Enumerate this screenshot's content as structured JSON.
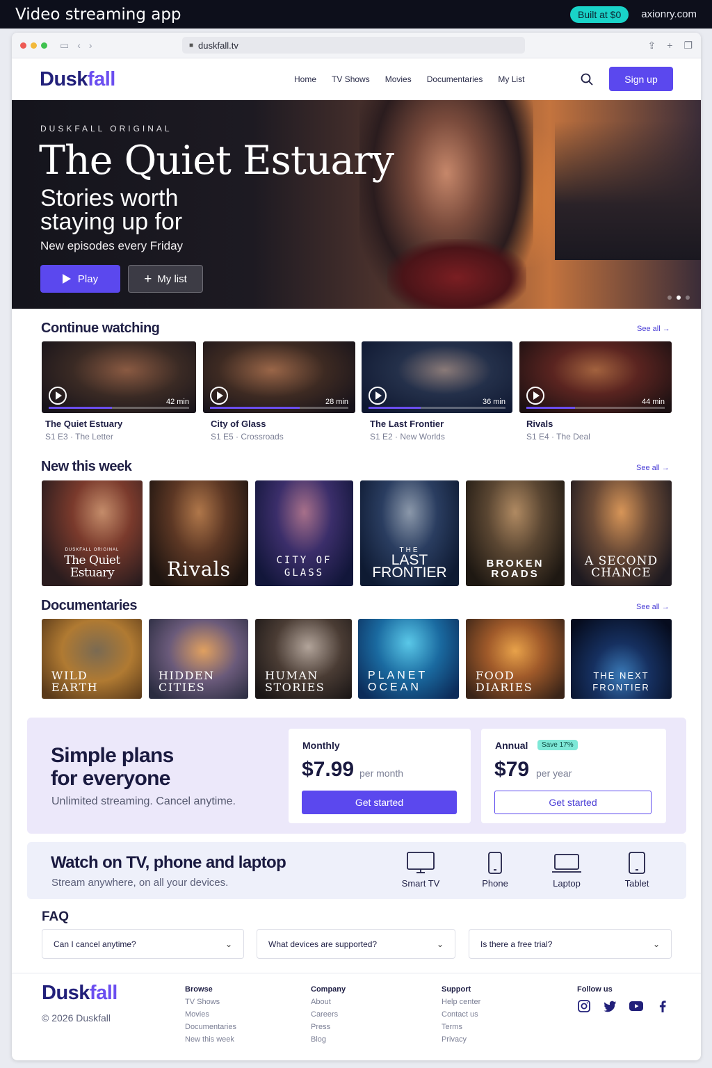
{
  "banner": {
    "title": "Video streaming app",
    "badge": "Built at $0",
    "domain": "axionry.com"
  },
  "browser": {
    "url": "duskfall.tv"
  },
  "nav": {
    "logo_a": "Dusk",
    "logo_b": "fall",
    "items": [
      "Home",
      "TV Shows",
      "Movies",
      "Documentaries",
      "My List"
    ],
    "signup": "Sign up"
  },
  "hero": {
    "eyebrow": "DUSKFALL ORIGINAL",
    "title": "The Quiet Estuary",
    "subtitle": "Stories worth staying up for",
    "desc": "New episodes every Friday",
    "play": "Play",
    "mylist": "My list",
    "slide_count": 3,
    "active_slide": 2
  },
  "continue": {
    "heading": "Continue watching",
    "see_all": "See all",
    "items": [
      {
        "title": "The Quiet Estuary",
        "sub": "S1 E3 · The Letter",
        "dur": "42 min",
        "progress": 0.45
      },
      {
        "title": "City of Glass",
        "sub": "S1 E5 · Crossroads",
        "dur": "28 min",
        "progress": 0.65
      },
      {
        "title": "The Last Frontier",
        "sub": "S1 E2 · New Worlds",
        "dur": "36 min",
        "progress": 0.38
      },
      {
        "title": "Rivals",
        "sub": "S1 E4 · The Deal",
        "dur": "44 min",
        "progress": 0.35
      }
    ]
  },
  "new": {
    "heading": "New this week",
    "see_all": "See all",
    "items": [
      {
        "title": "The Quiet Estuary",
        "eyebrow": "DUSKFALL ORIGINAL"
      },
      {
        "title": "Rivals",
        "eyebrow": ""
      },
      {
        "title": "CITY OF GLASS",
        "eyebrow": ""
      },
      {
        "title": "LAST FRONTIER",
        "eyebrow": "THE"
      },
      {
        "title": "BROKEN ROADS",
        "eyebrow": ""
      },
      {
        "title": "A SECOND CHANCE",
        "eyebrow": ""
      }
    ]
  },
  "docs": {
    "heading": "Documentaries",
    "see_all": "See all",
    "items": [
      {
        "title": "WILD EARTH"
      },
      {
        "title": "HIDDEN CITIES"
      },
      {
        "title": "HUMAN STORIES"
      },
      {
        "title": "PLANET OCEAN"
      },
      {
        "title": "FOOD DIARIES"
      },
      {
        "title": "THE NEXT FRONTIER"
      }
    ]
  },
  "plans": {
    "heading": "Simple plans for everyone",
    "sub": "Unlimited streaming. Cancel anytime.",
    "monthly": {
      "name": "Monthly",
      "price": "$7.99",
      "per": "per month",
      "cta": "Get started"
    },
    "annual": {
      "name": "Annual",
      "badge": "Save 17%",
      "price": "$79",
      "per": "per year",
      "cta": "Get started"
    }
  },
  "devices": {
    "heading": "Watch on TV, phone and laptop",
    "sub": "Stream anywhere, on all your devices.",
    "items": [
      "Smart TV",
      "Phone",
      "Laptop",
      "Tablet"
    ]
  },
  "faq": {
    "heading": "FAQ",
    "items": [
      "Can I cancel anytime?",
      "What devices are supported?",
      "Is there a free trial?"
    ]
  },
  "footer": {
    "copyright": "© 2026 Duskfall",
    "cols": [
      {
        "head": "Browse",
        "links": [
          "TV Shows",
          "Movies",
          "Documentaries",
          "New this week"
        ]
      },
      {
        "head": "Company",
        "links": [
          "About",
          "Careers",
          "Press",
          "Blog"
        ]
      },
      {
        "head": "Support",
        "links": [
          "Help center",
          "Contact us",
          "Terms",
          "Privacy"
        ]
      },
      {
        "head": "Follow us",
        "links": []
      }
    ],
    "social": [
      "instagram-icon",
      "twitter-icon",
      "youtube-icon",
      "facebook-icon"
    ]
  },
  "colors": {
    "accent": "#5b48ee",
    "navy": "#22207a",
    "teal": "#19d3c8"
  }
}
